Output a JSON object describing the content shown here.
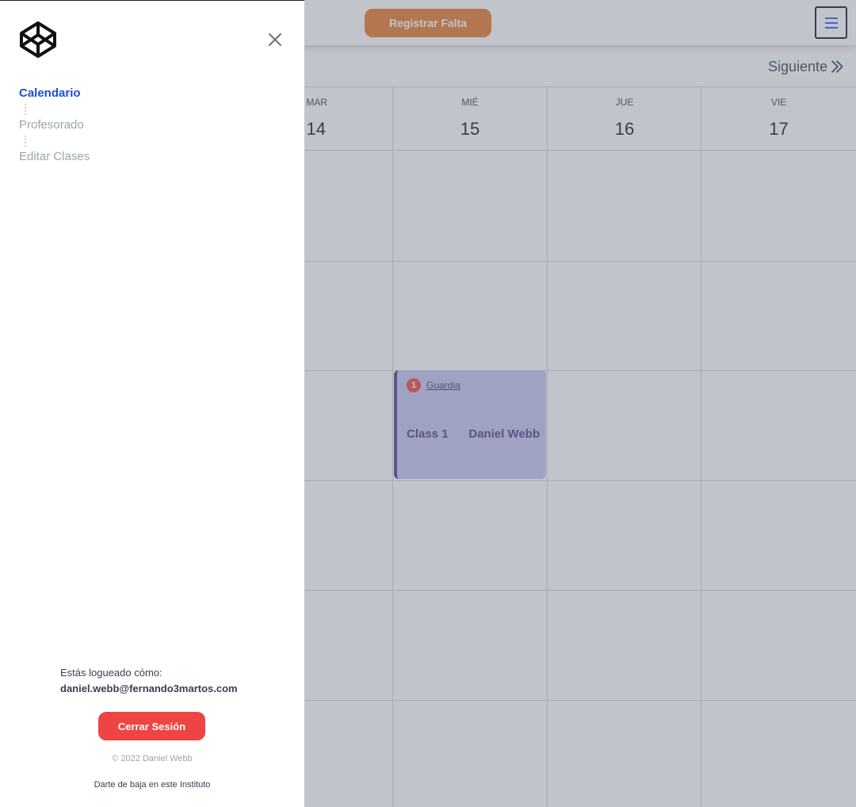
{
  "topbar": {
    "register_absence_label": "Registrar Falta",
    "menu_icon": "hamburger-icon",
    "next_label": "Siguiente",
    "next_icon": "chevrons-right-icon"
  },
  "calendar": {
    "days": [
      {
        "name": "MAR",
        "number": "14"
      },
      {
        "name": "MIÉ",
        "number": "15"
      },
      {
        "name": "JUE",
        "number": "16"
      },
      {
        "name": "VIE",
        "number": "17"
      }
    ],
    "event": {
      "badge": "1",
      "tag": "Guardia",
      "class_name": "Class 1",
      "teacher": "Daniel Webb",
      "day": "MIÉ",
      "accent": "#4c3d8a",
      "background": "#c7c4f3"
    }
  },
  "sidebar": {
    "logo_icon": "codepen-logo-icon",
    "close_icon": "close-icon",
    "nav": [
      {
        "label": "Calendario",
        "active": true
      },
      {
        "label": "Profesorado",
        "active": false
      },
      {
        "label": "Editar Clases",
        "active": false
      }
    ],
    "login_prefix": "Estás logueado cómo:",
    "login_email": "daniel.webb@fernando3martos.com",
    "logout_label": "Cerrar Sesión",
    "copyright": "© 2022 Daniel Webb",
    "unsubscribe": "Darte de baja en este Instituto"
  },
  "colors": {
    "accent_blue": "#1d4ed8",
    "orange_button": "#e67a2e",
    "red_button": "#ef4444"
  }
}
